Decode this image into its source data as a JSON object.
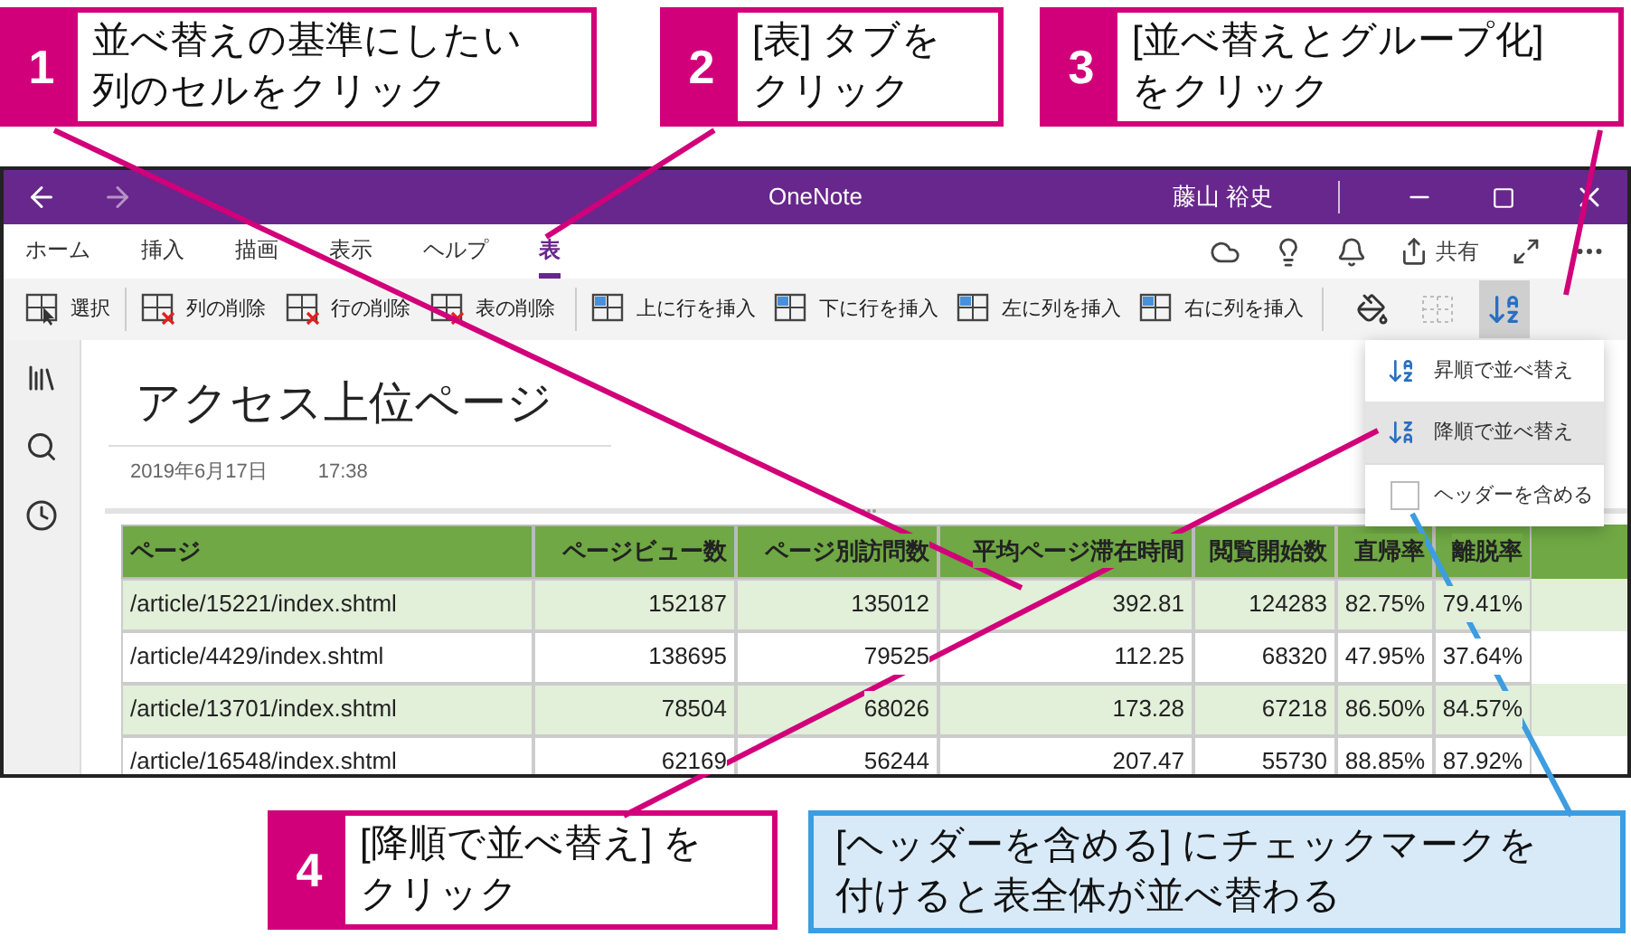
{
  "callouts_top": [
    {
      "kind": "step",
      "number": "1",
      "text": "並べ替えの基準にしたい列のセルをクリック"
    },
    {
      "kind": "step",
      "number": "2",
      "text": "[表] タブをクリック"
    },
    {
      "kind": "step",
      "number": "3",
      "text": "[並べ替えとグループ化]をクリック"
    }
  ],
  "window": {
    "title": "OneNote",
    "user": "藤山 裕史",
    "tabs": [
      {
        "label": "ホーム",
        "selected": false
      },
      {
        "label": "挿入",
        "selected": false
      },
      {
        "label": "描画",
        "selected": false
      },
      {
        "label": "表示",
        "selected": false
      },
      {
        "label": "ヘルプ",
        "selected": false
      },
      {
        "label": "表",
        "selected": true
      }
    ],
    "share_label": "共有",
    "toolbar": [
      {
        "kind": "select",
        "label": "選択",
        "selected": false
      },
      {
        "kind": "delete-column",
        "label": "列の削除",
        "selected": false
      },
      {
        "kind": "delete-row",
        "label": "行の削除",
        "selected": false
      },
      {
        "kind": "delete-table",
        "label": "表の削除",
        "selected": false
      },
      {
        "kind": "insert-above",
        "label": "上に行を挿入",
        "selected": false
      },
      {
        "kind": "insert-below",
        "label": "下に行を挿入",
        "selected": false
      },
      {
        "kind": "insert-left",
        "label": "左に列を挿入",
        "selected": false
      },
      {
        "kind": "insert-right",
        "label": "右に列を挿入",
        "selected": false
      },
      {
        "kind": "shading",
        "selected": false
      },
      {
        "kind": "borders",
        "selected": false
      },
      {
        "kind": "sort",
        "selected": true
      }
    ],
    "page": {
      "title": "アクセス上位ページ",
      "date": "2019年6月17日",
      "time": "17:38",
      "table": {
        "columns": [
          "ページ",
          "ページビュー数",
          "ページ別訪問数",
          "平均ページ滞在時間",
          "閲覧開始数",
          "直帰率",
          "離脱率"
        ],
        "rows": [
          [
            "/article/15221/index.shtml",
            "152187",
            "135012",
            "392.81",
            "124283",
            "82.75%",
            "79.41%"
          ],
          [
            "/article/4429/index.shtml",
            "138695",
            "79525",
            "112.25",
            "68320",
            "47.95%",
            "37.64%"
          ],
          [
            "/article/13701/index.shtml",
            "78504",
            "68026",
            "173.28",
            "67218",
            "86.50%",
            "84.57%"
          ],
          [
            "/article/16548/index.shtml",
            "62169",
            "56244",
            "207.47",
            "55730",
            "88.85%",
            "87.92%"
          ]
        ]
      }
    },
    "sort_menu": {
      "items": [
        {
          "kind": "asc",
          "label": "昇順で並べ替え",
          "selected": false
        },
        {
          "kind": "desc",
          "label": "降順で並べ替え",
          "selected": true
        }
      ],
      "header_option": {
        "label": "ヘッダーを含める",
        "checked": false
      }
    }
  },
  "callouts_bottom": [
    {
      "kind": "step",
      "number": "4",
      "text": "[降順で並べ替え] をクリック"
    },
    {
      "kind": "note",
      "text": "[ヘッダーを含める] にチェックマークを付けると表全体が並べ替わる"
    }
  ]
}
